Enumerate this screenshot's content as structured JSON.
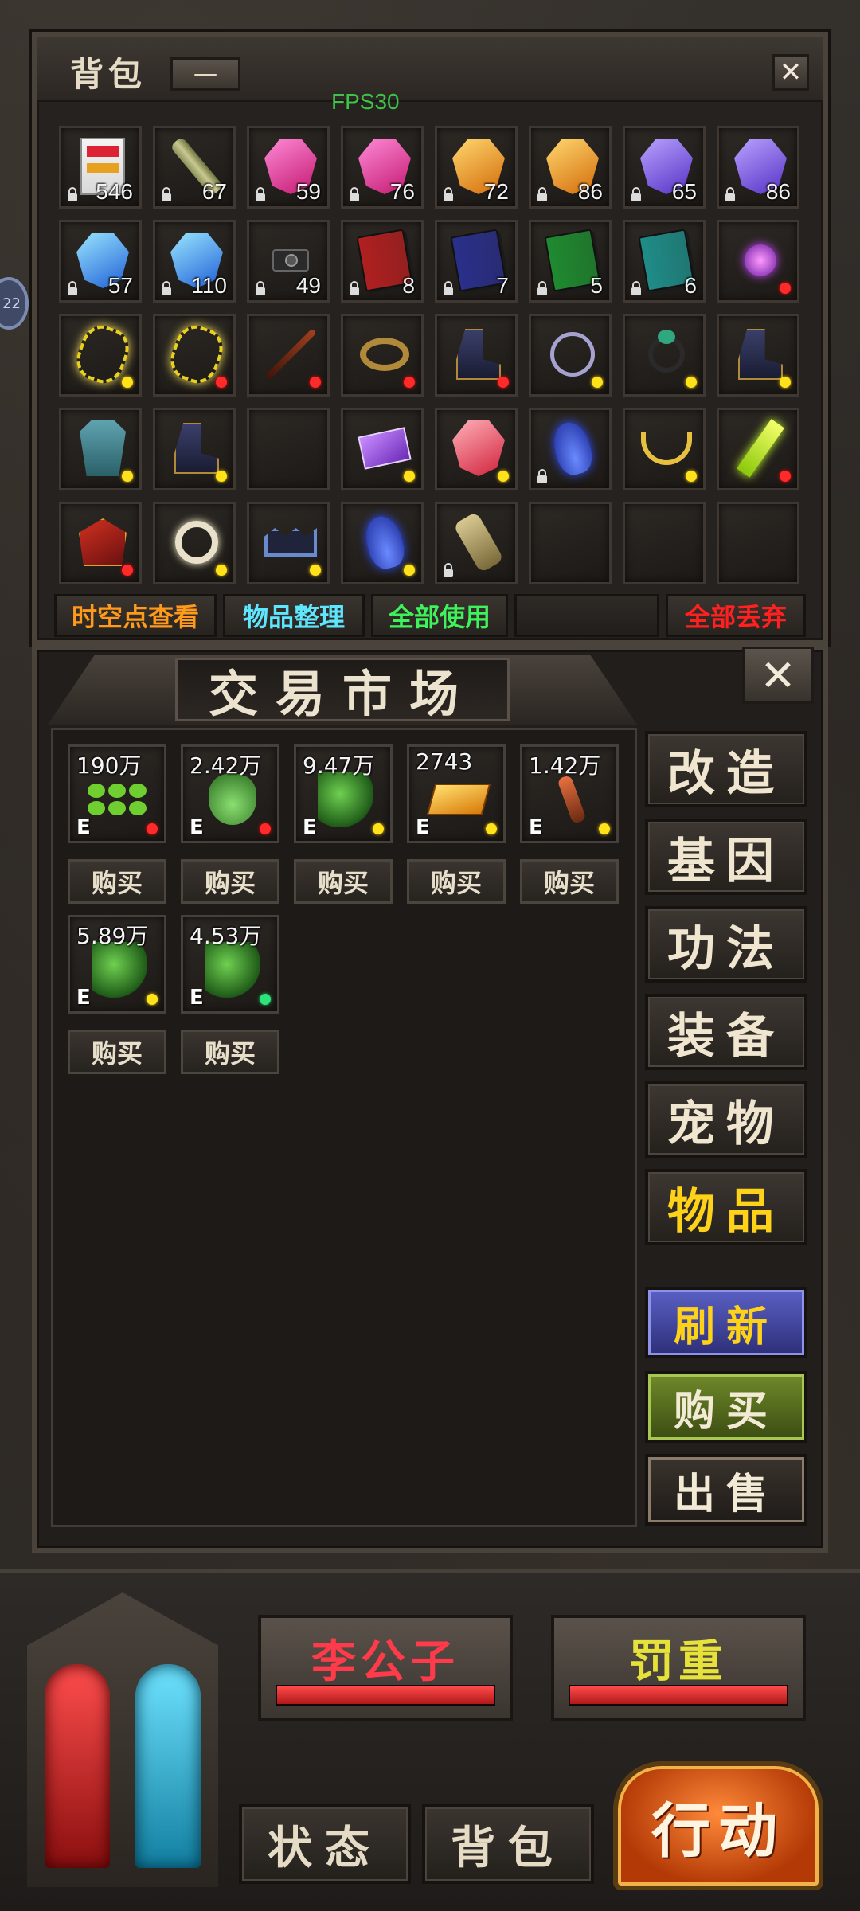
{
  "fps": "FPS30",
  "side_badge": "22",
  "bag": {
    "title": "背包",
    "minimize_label": "一",
    "close_label": "✕",
    "slots": [
      {
        "icon": "potion-box-icon",
        "count": "546"
      },
      {
        "icon": "scroll-icon",
        "count": "67"
      },
      {
        "icon": "pink-gem-icon",
        "count": "59"
      },
      {
        "icon": "pink-gem-icon",
        "count": "76"
      },
      {
        "icon": "orange-gem-icon",
        "count": "72"
      },
      {
        "icon": "orange-gem-icon",
        "count": "86"
      },
      {
        "icon": "purple-gem-icon",
        "count": "65"
      },
      {
        "icon": "purple-gem-icon",
        "count": "86"
      },
      {
        "icon": "blue-crystal-icon",
        "count": "57"
      },
      {
        "icon": "blue-crystal-icon",
        "count": "110"
      },
      {
        "icon": "camera-icon",
        "count": "49"
      },
      {
        "icon": "red-book-icon",
        "count": "8"
      },
      {
        "icon": "blue-book-icon",
        "count": "7"
      },
      {
        "icon": "green-book-icon",
        "count": "5"
      },
      {
        "icon": "teal-book-icon",
        "count": "6"
      },
      {
        "icon": "purple-orb-icon",
        "count": ""
      },
      {
        "icon": "yellow-aura-icon",
        "count": ""
      },
      {
        "icon": "yellow-aura-icon",
        "count": ""
      },
      {
        "icon": "staff-icon",
        "count": ""
      },
      {
        "icon": "belt-icon",
        "count": ""
      },
      {
        "icon": "boots-icon",
        "count": ""
      },
      {
        "icon": "bracelet-icon",
        "count": ""
      },
      {
        "icon": "ring-icon",
        "count": ""
      },
      {
        "icon": "boots-icon",
        "count": ""
      },
      {
        "icon": "armor-icon",
        "count": ""
      },
      {
        "icon": "boots-icon",
        "count": ""
      },
      {
        "icon": "empty-slot",
        "count": ""
      },
      {
        "icon": "purple-card-icon",
        "count": ""
      },
      {
        "icon": "red-crystal-icon",
        "count": ""
      },
      {
        "icon": "blue-flame-icon",
        "count": ""
      },
      {
        "icon": "necklace-icon",
        "count": ""
      },
      {
        "icon": "lightning-icon",
        "count": ""
      },
      {
        "icon": "dragon-armor-icon",
        "count": ""
      },
      {
        "icon": "silver-ring-icon",
        "count": ""
      },
      {
        "icon": "crown-icon",
        "count": ""
      },
      {
        "icon": "blue-flame-icon",
        "count": ""
      },
      {
        "icon": "gauntlet-icon",
        "count": ""
      },
      {
        "icon": "empty-slot",
        "count": ""
      },
      {
        "icon": "empty-slot",
        "count": ""
      },
      {
        "icon": "empty-slot",
        "count": ""
      }
    ],
    "actions": {
      "view_points": "时空点查看",
      "sort_items": "物品整理",
      "use_all": "全部使用",
      "discard_all": "全部丢弃"
    }
  },
  "market": {
    "title": "交易市场",
    "close_label": "✕",
    "buy_label": "购买",
    "items": [
      {
        "price": "190万",
        "grade": "E",
        "icon": "green-seeds-icon",
        "dot": "red"
      },
      {
        "price": "2.42万",
        "grade": "E",
        "icon": "green-flask-icon",
        "dot": "red"
      },
      {
        "price": "9.47万",
        "grade": "E",
        "icon": "herb-icon",
        "dot": "yellow"
      },
      {
        "price": "2743",
        "grade": "E",
        "icon": "gold-block-icon",
        "dot": "yellow"
      },
      {
        "price": "1.42万",
        "grade": "E",
        "icon": "root-icon",
        "dot": "yellow"
      },
      {
        "price": "5.89万",
        "grade": "E",
        "icon": "herb-icon",
        "dot": "yellow"
      },
      {
        "price": "4.53万",
        "grade": "E",
        "icon": "herb-icon",
        "dot": "green"
      }
    ],
    "categories": [
      {
        "label": "改造",
        "active": false
      },
      {
        "label": "基因",
        "active": false
      },
      {
        "label": "功法",
        "active": false
      },
      {
        "label": "装备",
        "active": false
      },
      {
        "label": "宠物",
        "active": false
      },
      {
        "label": "物品",
        "active": true
      }
    ],
    "refresh_label": "刷新",
    "purchase_label": "购买",
    "sell_label": "出售"
  },
  "hud": {
    "player_name": "李公子",
    "target_name": "罚重",
    "player_hp": 1.0,
    "target_hp": 1.0,
    "tab_status": "状态",
    "tab_bag": "背包",
    "action_label": "行动"
  }
}
